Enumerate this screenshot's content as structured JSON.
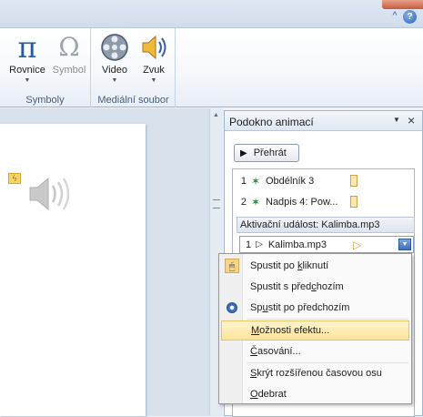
{
  "ribbon": {
    "groups": [
      {
        "label": "Symboly",
        "buttons": [
          "Rovnice",
          "Symbol"
        ]
      },
      {
        "label": "Mediální soubor",
        "buttons": [
          "Video",
          "Zvuk"
        ]
      }
    ]
  },
  "window": {
    "help_label": "?",
    "minimize_ribbon_glyph": "^"
  },
  "pane": {
    "title": "Podokno animací",
    "play_label": "Přehrát",
    "items": [
      {
        "num": "1",
        "name": "Obdélník 3",
        "icon": "green-star-icon"
      },
      {
        "num": "2",
        "name": "Nadpis 4: Pow...",
        "icon": "green-star-icon"
      }
    ],
    "trigger_label": "Aktivační událost: Kalimba.mp3",
    "selected_item": {
      "num": "1",
      "name": "Kalimba.mp3",
      "icon": "play-triangle-icon"
    }
  },
  "context_menu": {
    "items": [
      {
        "pre": "Spustit po ",
        "acc": "k",
        "post": "liknutí",
        "icon": "mouse-icon"
      },
      {
        "pre": "Spustit s před",
        "acc": "c",
        "post": "hozím",
        "icon": ""
      },
      {
        "pre": "Sp",
        "acc": "u",
        "post": "stit po předchozím",
        "icon": "clock-icon"
      },
      {
        "pre": "",
        "acc": "M",
        "post": "ožnosti efektu...",
        "icon": ""
      },
      {
        "pre": "",
        "acc": "Č",
        "post": "asování...",
        "icon": ""
      },
      {
        "pre": "",
        "acc": "S",
        "post": "krýt rozšířenou časovou osu",
        "icon": ""
      },
      {
        "pre": "",
        "acc": "O",
        "post": "debrat",
        "icon": ""
      }
    ],
    "highlighted_index": 3
  },
  "colors": {
    "accent": "#2a62b5",
    "menu_highlight": "#fde49a",
    "timing_bar": "#fde8b0"
  }
}
